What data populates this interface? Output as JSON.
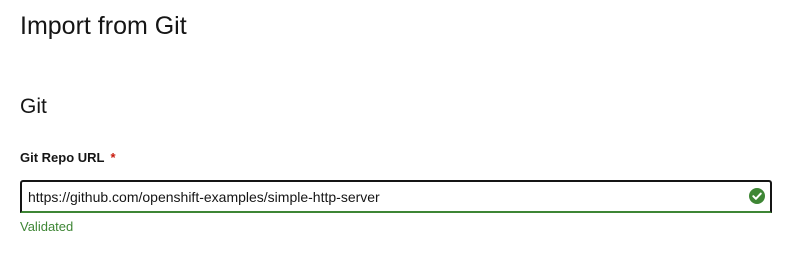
{
  "page": {
    "title": "Import from Git"
  },
  "section": {
    "title": "Git"
  },
  "git_repo_url": {
    "label": "Git Repo URL",
    "required_marker": "*",
    "value": "https://github.com/openshift-examples/simple-http-server",
    "status_icon": "check-circle-icon",
    "helper_text": "Validated",
    "status_color": "#3e8635",
    "required_color": "#c9190b"
  }
}
